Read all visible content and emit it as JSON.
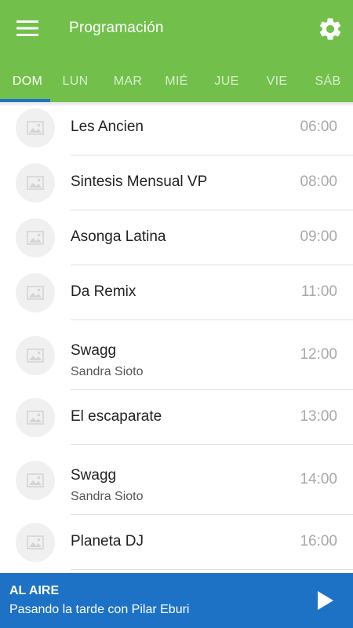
{
  "header": {
    "title": "Programación",
    "menu_icon": "hamburger-menu-icon",
    "settings_icon": "gear-icon",
    "color": "#72c04b"
  },
  "tabs": [
    {
      "label": "DOM",
      "active": true
    },
    {
      "label": "LUN",
      "active": false
    },
    {
      "label": "MAR",
      "active": false
    },
    {
      "label": "MIÉ",
      "active": false
    },
    {
      "label": "JUE",
      "active": false
    },
    {
      "label": "VIE",
      "active": false
    },
    {
      "label": "SÁB",
      "active": false
    }
  ],
  "accent_color": "#1d72c6",
  "schedule": [
    {
      "title": "Les Ancien",
      "subtitle": "",
      "time": "06:00",
      "icon": "image-placeholder-icon"
    },
    {
      "title": "Sintesis Mensual VP",
      "subtitle": "",
      "time": "08:00",
      "icon": "image-placeholder-icon"
    },
    {
      "title": "Asonga Latina",
      "subtitle": "",
      "time": "09:00",
      "icon": "image-placeholder-icon"
    },
    {
      "title": "Da Remix",
      "subtitle": "",
      "time": "11:00",
      "icon": "image-placeholder-icon"
    },
    {
      "title": "Swagg",
      "subtitle": "Sandra Sioto",
      "time": "12:00",
      "icon": "image-placeholder-icon"
    },
    {
      "title": "El escaparate",
      "subtitle": "",
      "time": "13:00",
      "icon": "image-placeholder-icon"
    },
    {
      "title": "Swagg",
      "subtitle": "Sandra Sioto",
      "time": "14:00",
      "icon": "image-placeholder-icon"
    },
    {
      "title": "Planeta DJ",
      "subtitle": "",
      "time": "16:00",
      "icon": "image-placeholder-icon"
    }
  ],
  "player": {
    "label": "AL AIRE",
    "show": "Pasando la tarde con Pilar Eburi",
    "play_icon": "play-icon"
  }
}
